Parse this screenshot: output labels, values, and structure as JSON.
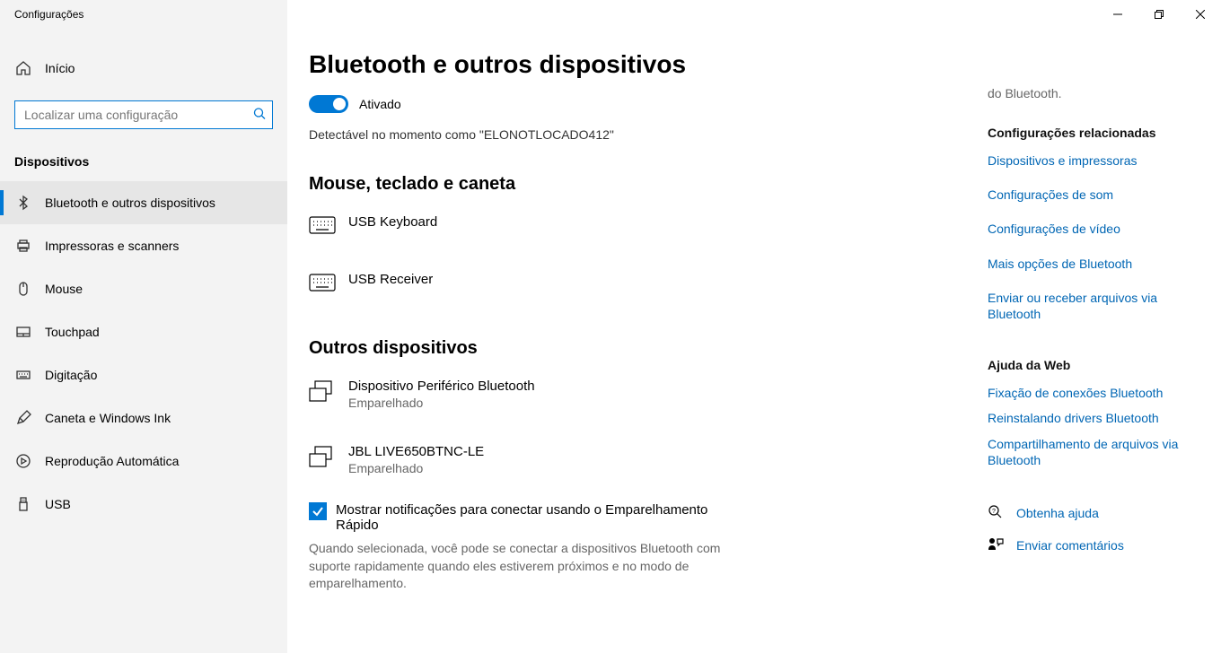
{
  "window_title": "Configurações",
  "sidebar": {
    "home": "Início",
    "search_placeholder": "Localizar uma configuração",
    "category": "Dispositivos",
    "items": [
      {
        "label": "Bluetooth e outros dispositivos"
      },
      {
        "label": "Impressoras e scanners"
      },
      {
        "label": "Mouse"
      },
      {
        "label": "Touchpad"
      },
      {
        "label": "Digitação"
      },
      {
        "label": "Caneta e Windows Ink"
      },
      {
        "label": "Reprodução Automática"
      },
      {
        "label": "USB"
      }
    ]
  },
  "page": {
    "title": "Bluetooth e outros dispositivos",
    "toggle_state": "Ativado",
    "discoverable": "Detectável no momento como \"ELONOTLOCADO412\"",
    "section_mouse": "Mouse, teclado e caneta",
    "devices_mouse": [
      {
        "name": "USB Keyboard"
      },
      {
        "name": "USB Receiver"
      }
    ],
    "section_other": "Outros dispositivos",
    "devices_other": [
      {
        "name": "Dispositivo Periférico Bluetooth",
        "status": "Emparelhado"
      },
      {
        "name": "JBL LIVE650BTNC-LE",
        "status": "Emparelhado"
      }
    ],
    "quick_pair_label": "Mostrar notificações para conectar usando o Emparelhamento Rápido",
    "quick_pair_desc": "Quando selecionada, você pode se conectar a dispositivos Bluetooth com suporte rapidamente quando eles estiverem próximos e no modo de emparelhamento."
  },
  "aside": {
    "partial_top": "do Bluetooth.",
    "related_head": "Configurações relacionadas",
    "related": [
      "Dispositivos e impressoras",
      "Configurações de som",
      "Configurações de vídeo",
      "Mais opções de Bluetooth",
      "Enviar ou receber arquivos via Bluetooth"
    ],
    "help_head": "Ajuda da Web",
    "help": [
      "Fixação de conexões Bluetooth",
      "Reinstalando drivers Bluetooth",
      "Compartilhamento de arquivos via Bluetooth"
    ],
    "get_help": "Obtenha ajuda",
    "feedback": "Enviar comentários"
  }
}
